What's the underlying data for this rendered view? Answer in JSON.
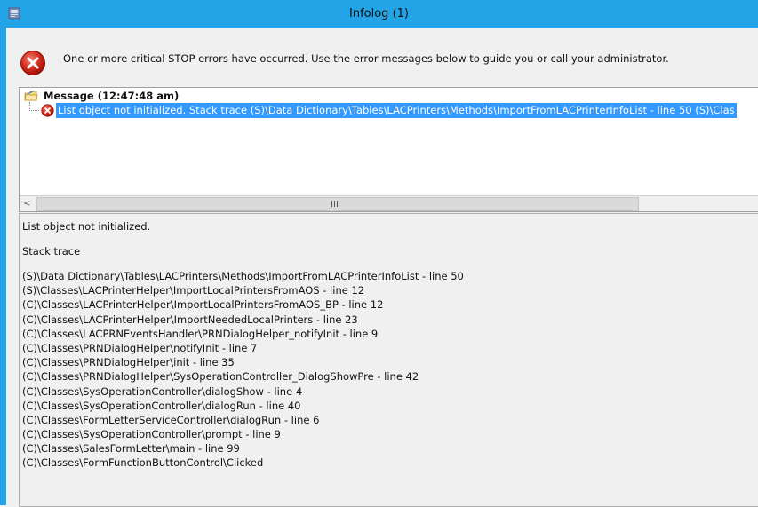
{
  "window": {
    "title": "Infolog (1)",
    "accent_color": "#23a4e6",
    "icon": "infolog-app-icon"
  },
  "summary": {
    "icon": "error-icon",
    "text": "One or more critical STOP errors have occurred. Use the error messages below to guide you or call your administrator."
  },
  "tree": {
    "group": {
      "icon": "message-folder-icon",
      "label": "Message (12:47:48 am)"
    },
    "items": [
      {
        "icon": "error-icon",
        "text": "List object not initialized.  Stack trace  (S)\\Data Dictionary\\Tables\\LACPrinters\\Methods\\ImportFromLACPrinterInfoList - line 50 (S)\\Clas",
        "selected": true,
        "selection_color": "#3399ff"
      }
    ],
    "scrollbar": {
      "left_arrow": "<",
      "thumb_grip": "III"
    }
  },
  "splitter": {
    "grip": "...."
  },
  "details": {
    "message": "List object not initialized.",
    "stack_heading": "Stack trace",
    "trace": [
      "(S)\\Data Dictionary\\Tables\\LACPrinters\\Methods\\ImportFromLACPrinterInfoList - line 50",
      "(S)\\Classes\\LACPrinterHelper\\ImportLocalPrintersFromAOS - line 12",
      "(C)\\Classes\\LACPrinterHelper\\ImportLocalPrintersFromAOS_BP - line 12",
      "(C)\\Classes\\LACPrinterHelper\\ImportNeededLocalPrinters - line 23",
      "(C)\\Classes\\LACPRNEventsHandler\\PRNDialogHelper_notifyInit - line 9",
      "(C)\\Classes\\PRNDialogHelper\\notifyInit - line 7",
      "(C)\\Classes\\PRNDialogHelper\\init - line 35",
      "(C)\\Classes\\PRNDialogHelper\\SysOperationController_DialogShowPre - line 42",
      "(C)\\Classes\\SysOperationController\\dialogShow - line 4",
      "(C)\\Classes\\SysOperationController\\dialogRun - line 40",
      "(C)\\Classes\\FormLetterServiceController\\dialogRun - line 6",
      "(C)\\Classes\\SysOperationController\\prompt - line 9",
      "(C)\\Classes\\SalesFormLetter\\main - line 99",
      "(C)\\Classes\\FormFunctionButtonControl\\Clicked"
    ]
  }
}
